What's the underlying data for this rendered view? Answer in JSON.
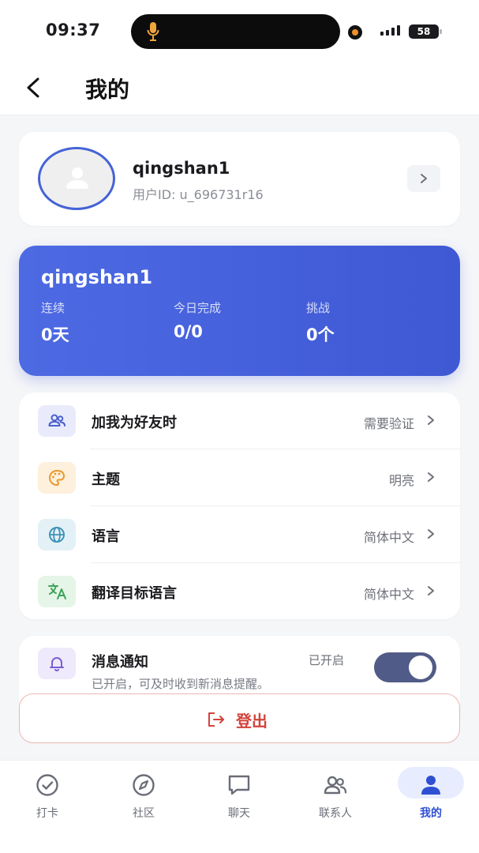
{
  "status_bar": {
    "time": "09:37",
    "battery": "58",
    "accent_record": "#f0902a"
  },
  "header": {
    "title": "我的",
    "back_icon": "chevron-left-icon"
  },
  "profile": {
    "username": "qingshan1",
    "user_id": "用户ID: u_696731r16",
    "avatar_icon": "person-icon"
  },
  "stats": {
    "name": "qingshan1",
    "items": [
      {
        "label": "连续",
        "value": "0天"
      },
      {
        "label": "今日完成",
        "value": "0/0"
      },
      {
        "label": "挑战",
        "value": "0个"
      }
    ],
    "colors": {
      "start": "#4d6ae3",
      "end": "#3f58d4"
    }
  },
  "settings": {
    "items": [
      {
        "label": "加我为好友时",
        "value": "需要验证",
        "icon": "users-icon",
        "icon_bg": "#e9ebfb"
      },
      {
        "label": "主题",
        "value": "明亮",
        "icon": "palette-icon",
        "icon_bg": "#fdf0dc"
      },
      {
        "label": "语言",
        "value": "简体中文",
        "icon": "globe-icon",
        "icon_bg": "#e3f1f6"
      },
      {
        "label": "翻译目标语言",
        "value": "简体中文",
        "icon": "translate-icon",
        "icon_bg": "#e5f5e7"
      }
    ]
  },
  "notification": {
    "title": "消息通知",
    "description": "已开启，可及时收到新消息提醒。",
    "state": "已开启",
    "enabled": true,
    "icon": "bell-icon"
  },
  "logout": {
    "label": "登出",
    "icon": "logout-icon",
    "color": "#d3423c"
  },
  "tabbar": {
    "tabs": [
      {
        "label": "打卡",
        "icon": "check-circle-icon"
      },
      {
        "label": "社区",
        "icon": "compass-icon"
      },
      {
        "label": "聊天",
        "icon": "chat-icon"
      },
      {
        "label": "联系人",
        "icon": "contacts-icon"
      },
      {
        "label": "我的",
        "icon": "profile-icon",
        "active": true
      }
    ],
    "active_color": "#2f4fd2"
  }
}
